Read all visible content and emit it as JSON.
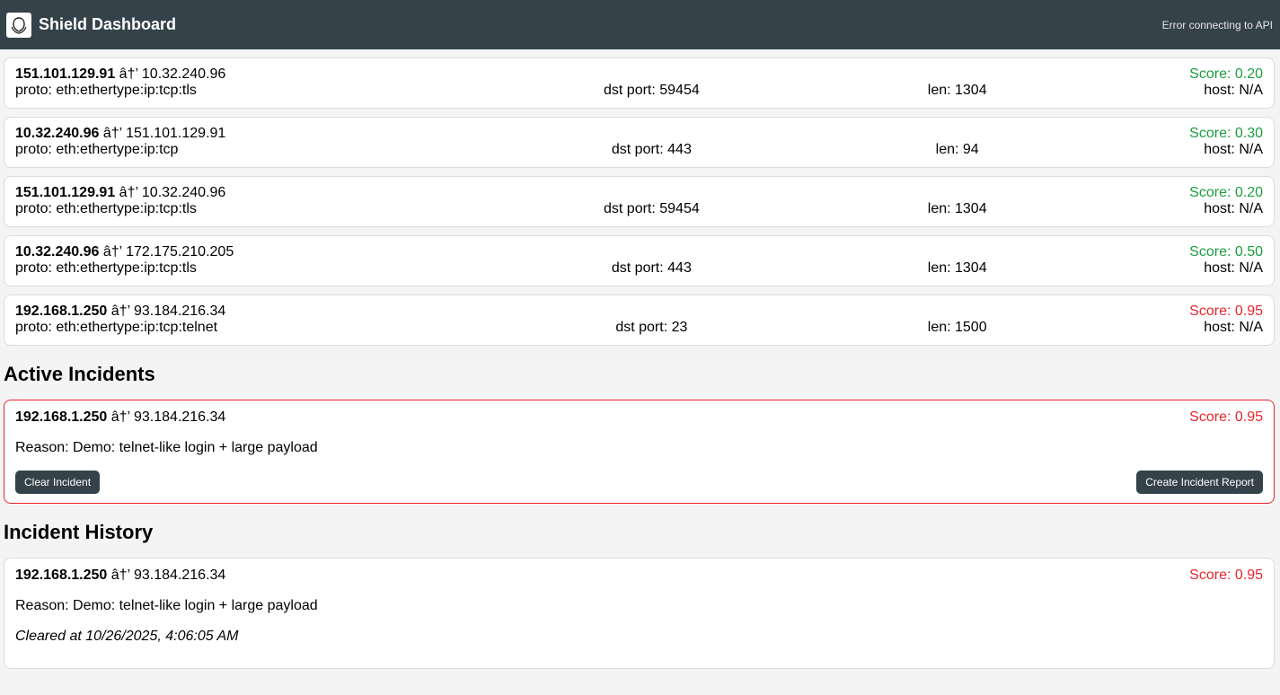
{
  "header": {
    "title": "Shield Dashboard",
    "logo_icon": "shield-logo-icon",
    "api_status": "Error connecting to API",
    "bar_color": "#35424a"
  },
  "packets": [
    {
      "src": "151.101.129.91",
      "arrow": "â†’",
      "dst": "10.32.240.96",
      "score": "Score: 0.20",
      "level": "low",
      "proto": "proto: eth:ethertype:ip:tcp:tls",
      "port": "dst port: 59454",
      "len": "len: 1304",
      "host": "host: N/A"
    },
    {
      "src": "10.32.240.96",
      "arrow": "â†’",
      "dst": "151.101.129.91",
      "score": "Score: 0.30",
      "level": "low",
      "proto": "proto: eth:ethertype:ip:tcp",
      "port": "dst port: 443",
      "len": "len: 94",
      "host": "host: N/A"
    },
    {
      "src": "151.101.129.91",
      "arrow": "â†’",
      "dst": "10.32.240.96",
      "score": "Score: 0.20",
      "level": "low",
      "proto": "proto: eth:ethertype:ip:tcp:tls",
      "port": "dst port: 59454",
      "len": "len: 1304",
      "host": "host: N/A"
    },
    {
      "src": "10.32.240.96",
      "arrow": "â†’",
      "dst": "172.175.210.205",
      "score": "Score: 0.50",
      "level": "low",
      "proto": "proto: eth:ethertype:ip:tcp:tls",
      "port": "dst port: 443",
      "len": "len: 1304",
      "host": "host: N/A"
    },
    {
      "src": "192.168.1.250",
      "arrow": "â†’",
      "dst": "93.184.216.34",
      "score": "Score: 0.95",
      "level": "high",
      "proto": "proto: eth:ethertype:ip:tcp:telnet",
      "port": "dst port: 23",
      "len": "len: 1500",
      "host": "host: N/A"
    }
  ],
  "active": {
    "heading": "Active Incidents",
    "src": "192.168.1.250",
    "arrow": "â†’",
    "dst": "93.184.216.34",
    "score": "Score: 0.95",
    "reason": "Reason: Demo: telnet-like login + large payload",
    "clear_label": "Clear Incident",
    "report_label": "Create Incident Report"
  },
  "history": {
    "heading": "Incident History",
    "src": "192.168.1.250",
    "arrow": "â†’",
    "dst": "93.184.216.34",
    "score": "Score: 0.95",
    "reason": "Reason: Demo: telnet-like login + large payload",
    "cleared": "Cleared at 10/26/2025, 4:06:05 AM"
  },
  "colors": {
    "score_low": "#1a9e3f",
    "score_high": "#e8262d",
    "active_border": "#e8262d"
  }
}
